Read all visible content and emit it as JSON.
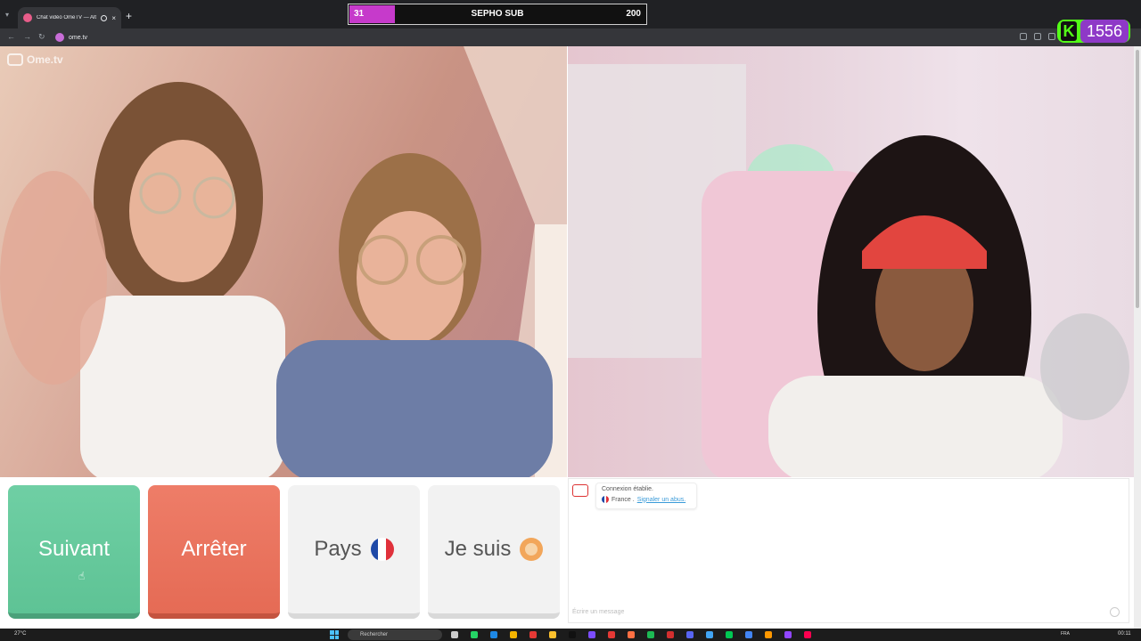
{
  "browser": {
    "tab_title": "Chat vidéo OmeTV — Alter...",
    "tab_close": "×",
    "new_tab": "+",
    "url": "ome.tv"
  },
  "overlay": {
    "sub_current": "31",
    "sub_label": "SEPHO SUB",
    "sub_goal": "200",
    "sub_progress": 0.155,
    "kick_letter": "K",
    "kick_count": "1556"
  },
  "site": {
    "watermark": "Ome.tv"
  },
  "controls": {
    "next_label": "Suivant",
    "stop_label": "Arrêter",
    "country_label": "Pays",
    "gender_label": "Je suis"
  },
  "chat": {
    "status_text": "Connexion établie.",
    "country_text": "France .",
    "report_link": "Signaler un abus.",
    "input_placeholder": "Écrire un message"
  },
  "taskbar": {
    "weather": "27°C",
    "search_placeholder": "Rechercher",
    "language": "FRA",
    "time": "00:11"
  },
  "colors": {
    "next": "#5ec395",
    "stop": "#e56b55",
    "sub_fill": "#c63acb",
    "kick_green": "#53fc18",
    "kick_purple": "#8e39c7"
  }
}
